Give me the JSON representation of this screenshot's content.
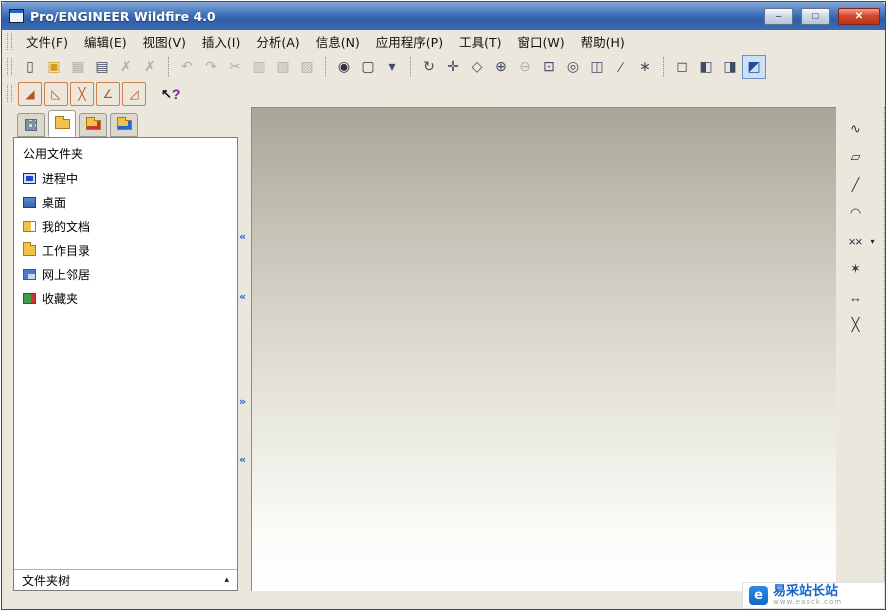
{
  "window": {
    "title": "Pro/ENGINEER Wildfire 4.0"
  },
  "titlebar": {
    "minimize": "–",
    "maximize": "□",
    "close": "✕"
  },
  "menu": {
    "items": [
      {
        "label": "文件(F)"
      },
      {
        "label": "编辑(E)"
      },
      {
        "label": "视图(V)"
      },
      {
        "label": "插入(I)"
      },
      {
        "label": "分析(A)"
      },
      {
        "label": "信息(N)"
      },
      {
        "label": "应用程序(P)"
      },
      {
        "label": "工具(T)"
      },
      {
        "label": "窗口(W)"
      },
      {
        "label": "帮助(H)"
      }
    ]
  },
  "toolbar_main": {
    "buttons": [
      {
        "name": "new-file",
        "glyph": "▯"
      },
      {
        "name": "open-file",
        "glyph": "▣"
      },
      {
        "name": "save-file",
        "glyph": "▦"
      },
      {
        "name": "print",
        "glyph": "▤"
      },
      {
        "name": "erase-display",
        "glyph": "✗"
      },
      {
        "name": "delete-old-versions",
        "glyph": "✗"
      },
      {
        "name": "undo",
        "glyph": "↶"
      },
      {
        "name": "redo",
        "glyph": "↷"
      },
      {
        "name": "cut",
        "glyph": "✂"
      },
      {
        "name": "copy",
        "glyph": "▥"
      },
      {
        "name": "paste",
        "glyph": "▧"
      },
      {
        "name": "paste-special",
        "glyph": "▨"
      },
      {
        "name": "search",
        "glyph": "◉"
      },
      {
        "name": "smart-select",
        "glyph": "▢"
      },
      {
        "name": "select-filter",
        "glyph": "▾"
      },
      {
        "name": "regenerate",
        "glyph": "↻"
      },
      {
        "name": "spin-center",
        "glyph": "✛"
      },
      {
        "name": "orient-mode",
        "glyph": "◇"
      },
      {
        "name": "zoom-in",
        "glyph": "⊕"
      },
      {
        "name": "zoom-out",
        "glyph": "⊖"
      },
      {
        "name": "refit",
        "glyph": "⊡"
      },
      {
        "name": "repaint",
        "glyph": "◎"
      },
      {
        "name": "datum-planes",
        "glyph": "◫"
      },
      {
        "name": "datum-axes",
        "glyph": "∕"
      },
      {
        "name": "datum-points",
        "glyph": "∗"
      },
      {
        "name": "wireframe-display",
        "glyph": "◻"
      },
      {
        "name": "hidden-line-display",
        "glyph": "◧"
      },
      {
        "name": "no-hidden-display",
        "glyph": "◨"
      },
      {
        "name": "shaded-display",
        "glyph": "◩"
      }
    ]
  },
  "toolbar_diag": {
    "buttons": [
      {
        "name": "diag-shade-closed-loops",
        "glyph": "◢"
      },
      {
        "name": "diag-highlight-open-ends",
        "glyph": "◺"
      },
      {
        "name": "diag-overlapping-geometry",
        "glyph": "╳"
      },
      {
        "name": "diag-feature-requirements",
        "glyph": "∠"
      },
      {
        "name": "diag-orientation",
        "glyph": "◿"
      }
    ],
    "help": {
      "arrow": "↖",
      "question": "?"
    }
  },
  "navigator": {
    "header": "公用文件夹",
    "items": [
      {
        "label": "进程中"
      },
      {
        "label": "桌面"
      },
      {
        "label": "我的文档"
      },
      {
        "label": "工作目录"
      },
      {
        "label": "网上邻居"
      },
      {
        "label": "收藏夹"
      }
    ],
    "footer": {
      "label": "文件夹树",
      "collapse": "▴"
    }
  },
  "splitter": {
    "chevrons": [
      "«",
      "«",
      "»",
      "«"
    ]
  },
  "right_tools": {
    "buttons": [
      {
        "name": "spline-tool",
        "glyph": "∿"
      },
      {
        "name": "rectangle-tool",
        "glyph": "▱"
      },
      {
        "name": "line-tool",
        "glyph": "╱"
      },
      {
        "name": "arc-tool",
        "glyph": "◠"
      },
      {
        "name": "delete-segment-tool",
        "glyph": "××"
      },
      {
        "name": "point-tool",
        "glyph": "✶"
      },
      {
        "name": "dimension-tool",
        "glyph": "↔"
      },
      {
        "name": "trim-tool",
        "glyph": "╳"
      }
    ],
    "dropdown": "▾"
  },
  "watermark": {
    "logo": "e",
    "title": "易采站长站",
    "subtitle": "www.easck.com"
  },
  "colors": {
    "titlebar_blue": "#3a6cb4",
    "close_red": "#cc3a28",
    "accent_blue": "#2a62d8",
    "folder_yellow": "#f0c24a",
    "canvas_top": "#a8a599",
    "canvas_bottom": "#ffffff"
  }
}
